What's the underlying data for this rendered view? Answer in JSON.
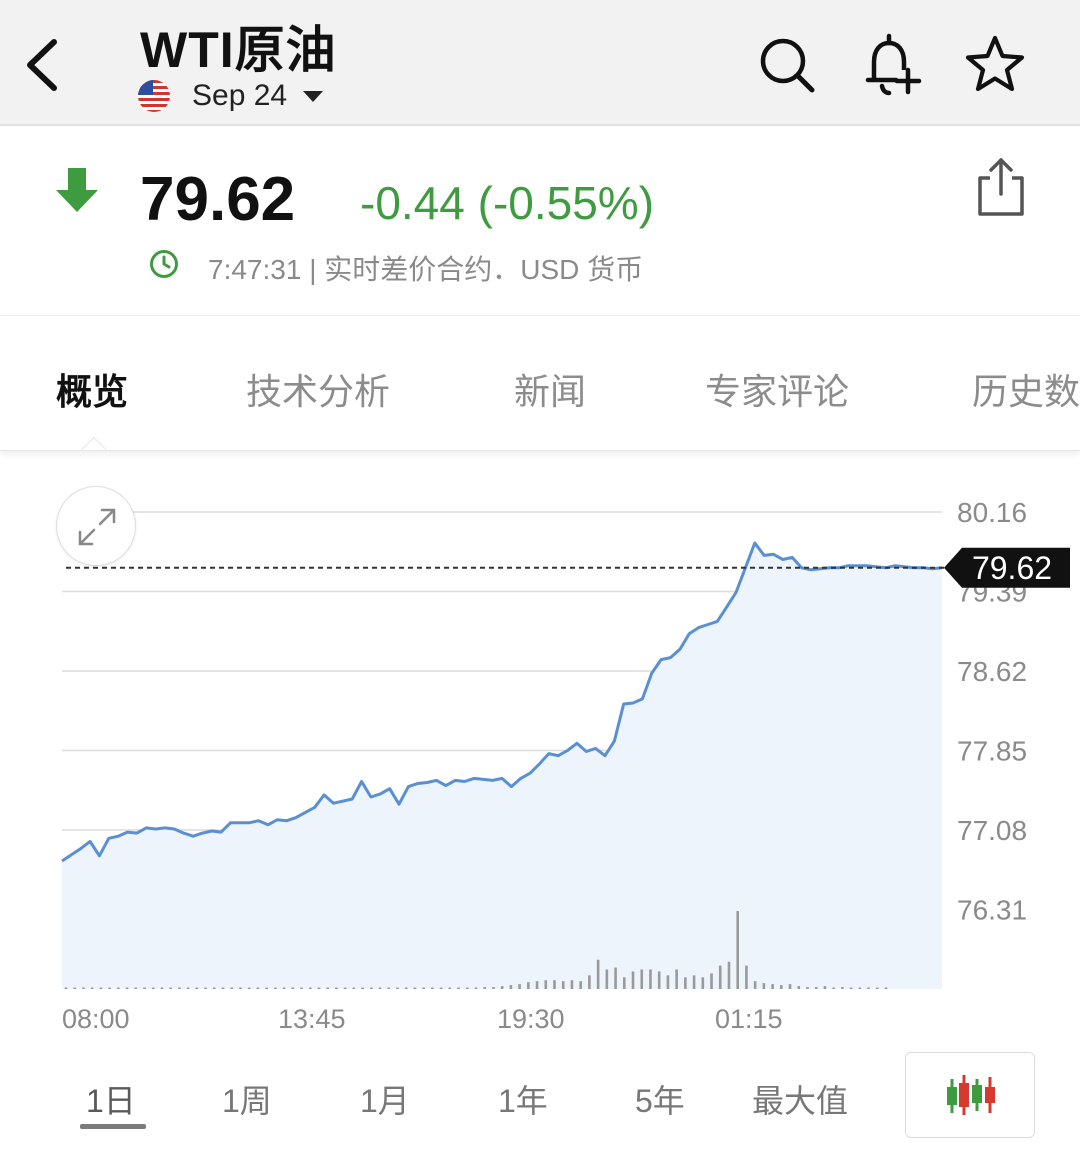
{
  "header": {
    "title": "WTI原油",
    "contract": "Sep 24"
  },
  "quote": {
    "price": "79.62",
    "change": "-0.44 (-0.55%)",
    "meta": "7:47:31 | 实时差价合约．USD 货币"
  },
  "tabs": [
    {
      "label": "概览",
      "active": true
    },
    {
      "label": "技术分析",
      "active": false
    },
    {
      "label": "新闻",
      "active": false
    },
    {
      "label": "专家评论",
      "active": false
    },
    {
      "label": "历史数据",
      "active": false
    }
  ],
  "ranges": [
    {
      "label": "1日",
      "active": true
    },
    {
      "label": "1周",
      "active": false
    },
    {
      "label": "1月",
      "active": false
    },
    {
      "label": "1年",
      "active": false
    },
    {
      "label": "5年",
      "active": false
    },
    {
      "label": "最大值",
      "active": false
    }
  ],
  "colors": {
    "down_green": "#3f9b3f",
    "line_blue": "#5b8fd3",
    "fill_blue": "#eef4fc",
    "candle_red": "#d63a2e",
    "candle_green": "#3f9b3f"
  },
  "chart_data": {
    "type": "line",
    "y_ticks": [
      "80.16",
      "79.39",
      "78.62",
      "77.85",
      "77.08",
      "76.31"
    ],
    "ylim": [
      75.54,
      80.16
    ],
    "x_ticks": [
      "08:00",
      "13:45",
      "19:30",
      "01:15"
    ],
    "current_value": "79.62",
    "current_value_num": 79.62,
    "series": [
      {
        "values": [
          76.78,
          76.84,
          76.9,
          76.97,
          76.83,
          77.0,
          77.02,
          77.06,
          77.05,
          77.1,
          77.09,
          77.1,
          77.09,
          77.05,
          77.02,
          77.05,
          77.07,
          77.06,
          77.15,
          77.15,
          77.15,
          77.17,
          77.13,
          77.18,
          77.17,
          77.2,
          77.25,
          77.3,
          77.42,
          77.34,
          77.36,
          77.38,
          77.55,
          77.4,
          77.43,
          77.48,
          77.33,
          77.5,
          77.53,
          77.54,
          77.56,
          77.51,
          77.56,
          77.55,
          77.58,
          77.57,
          77.56,
          77.58,
          77.5,
          77.58,
          77.63,
          77.72,
          77.82,
          77.8,
          77.85,
          77.92,
          77.84,
          77.87,
          77.8,
          77.94,
          78.3,
          78.31,
          78.35,
          78.6,
          78.73,
          78.75,
          78.83,
          78.98,
          79.04,
          79.07,
          79.1,
          79.24,
          79.38,
          79.62,
          79.86,
          79.74,
          79.75,
          79.7,
          79.72,
          79.62,
          79.6,
          79.61,
          79.62,
          79.62,
          79.64,
          79.64,
          79.64,
          79.63,
          79.62,
          79.64,
          79.63,
          79.62,
          79.62,
          79.61,
          79.62
        ]
      }
    ],
    "volume": [
      0,
      1,
      1,
      0,
      1,
      0,
      0,
      1,
      0,
      1,
      1,
      0,
      0,
      1,
      0,
      1,
      0,
      1,
      0,
      1,
      1,
      0,
      1,
      0,
      0,
      1,
      1,
      0,
      0,
      1,
      0,
      1,
      1,
      0,
      1,
      0,
      1,
      1,
      0,
      1,
      0,
      1,
      1,
      1,
      1,
      1,
      1,
      1,
      2,
      2,
      3,
      4,
      5,
      7,
      8,
      9,
      9,
      8,
      9,
      8,
      14,
      30,
      20,
      22,
      12,
      18,
      20,
      20,
      18,
      14,
      20,
      12,
      14,
      12,
      16,
      24,
      28,
      80,
      24,
      8,
      6,
      5,
      4,
      5,
      3,
      2,
      2,
      3,
      1,
      2,
      1,
      1,
      1,
      0,
      1
    ]
  }
}
